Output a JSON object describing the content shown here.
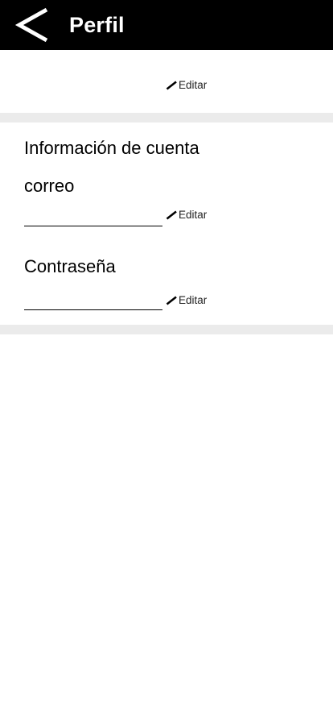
{
  "header": {
    "title": "Perfil",
    "back_icon": "chevron-left-icon",
    "background": "#000000"
  },
  "profile_section": {
    "edit_label": "Editar",
    "edit_icon": "pencil-icon"
  },
  "account_section": {
    "title": "Información de cuenta",
    "email": {
      "label": "correo",
      "value": "",
      "edit_label": "Editar"
    },
    "password": {
      "label": "Contraseña",
      "value": "",
      "edit_label": "Editar"
    }
  },
  "colors": {
    "divider": "#ebebeb",
    "text": "#000000"
  }
}
